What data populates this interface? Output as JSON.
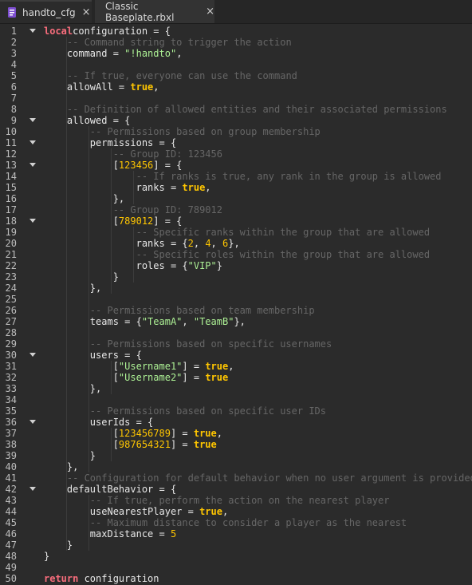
{
  "tabs": [
    {
      "label": "handto_cfg",
      "active": true
    },
    {
      "label": "Classic Baseplate.rbxl",
      "active": false
    }
  ],
  "close_glyph": "×",
  "colors": {
    "background": "#2b2b2b",
    "keyword": "#f86d7c",
    "boolean_number": "#ffc600",
    "string": "#adf195",
    "comment": "#666666",
    "text": "#e8e8e8"
  },
  "editor": {
    "lines": [
      {
        "n": "1",
        "fold": true,
        "tokens": [
          [
            "kw",
            "local"
          ],
          [
            "",
            "configuration = {"
          ]
        ]
      },
      {
        "n": "2",
        "tokens": [
          [
            "",
            "    "
          ],
          [
            "cm",
            "-- Command string to trigger the action"
          ]
        ]
      },
      {
        "n": "3",
        "tokens": [
          [
            "",
            "    command = "
          ],
          [
            "str",
            "\"!handto\""
          ],
          [
            "",
            ","
          ]
        ]
      },
      {
        "n": "4",
        "tokens": []
      },
      {
        "n": "5",
        "tokens": [
          [
            "",
            "    "
          ],
          [
            "cm",
            "-- If true, everyone can use the command"
          ]
        ]
      },
      {
        "n": "6",
        "tokens": [
          [
            "",
            "    allowAll = "
          ],
          [
            "bool",
            "true"
          ],
          [
            "",
            ","
          ]
        ]
      },
      {
        "n": "7",
        "tokens": []
      },
      {
        "n": "8",
        "tokens": [
          [
            "",
            "    "
          ],
          [
            "cm",
            "-- Definition of allowed entities and their associated permissions"
          ]
        ]
      },
      {
        "n": "9",
        "fold": true,
        "tokens": [
          [
            "",
            "    allowed = {"
          ]
        ]
      },
      {
        "n": "10",
        "tokens": [
          [
            "",
            "        "
          ],
          [
            "cm",
            "-- Permissions based on group membership"
          ]
        ]
      },
      {
        "n": "11",
        "fold": true,
        "tokens": [
          [
            "",
            "        permissions = {"
          ]
        ]
      },
      {
        "n": "12",
        "tokens": [
          [
            "",
            "            "
          ],
          [
            "cm",
            "-- Group ID: 123456"
          ]
        ]
      },
      {
        "n": "13",
        "fold": true,
        "tokens": [
          [
            "",
            "            ["
          ],
          [
            "num",
            "123456"
          ],
          [
            "",
            "] = {"
          ]
        ]
      },
      {
        "n": "14",
        "tokens": [
          [
            "",
            "                "
          ],
          [
            "cm",
            "-- If ranks is true, any rank in the group is allowed"
          ]
        ]
      },
      {
        "n": "15",
        "tokens": [
          [
            "",
            "                ranks = "
          ],
          [
            "bool",
            "true"
          ],
          [
            "",
            ","
          ]
        ]
      },
      {
        "n": "16",
        "tokens": [
          [
            "",
            "            },"
          ]
        ]
      },
      {
        "n": "17",
        "tokens": [
          [
            "",
            "            "
          ],
          [
            "cm",
            "-- Group ID: 789012"
          ]
        ]
      },
      {
        "n": "18",
        "fold": true,
        "tokens": [
          [
            "",
            "            ["
          ],
          [
            "num",
            "789012"
          ],
          [
            "",
            "] = {"
          ]
        ]
      },
      {
        "n": "19",
        "tokens": [
          [
            "",
            "                "
          ],
          [
            "cm",
            "-- Specific ranks within the group that are allowed"
          ]
        ]
      },
      {
        "n": "20",
        "tokens": [
          [
            "",
            "                ranks = {"
          ],
          [
            "num",
            "2"
          ],
          [
            "",
            ", "
          ],
          [
            "num",
            "4"
          ],
          [
            "",
            ", "
          ],
          [
            "num",
            "6"
          ],
          [
            "",
            "},"
          ]
        ]
      },
      {
        "n": "21",
        "tokens": [
          [
            "",
            "                "
          ],
          [
            "cm",
            "-- Specific roles within the group that are allowed"
          ]
        ]
      },
      {
        "n": "22",
        "tokens": [
          [
            "",
            "                roles = {"
          ],
          [
            "str",
            "\"VIP\""
          ],
          [
            "",
            "}"
          ]
        ]
      },
      {
        "n": "23",
        "tokens": [
          [
            "",
            "            }"
          ]
        ]
      },
      {
        "n": "24",
        "tokens": [
          [
            "",
            "        },"
          ]
        ]
      },
      {
        "n": "25",
        "tokens": []
      },
      {
        "n": "26",
        "tokens": [
          [
            "",
            "        "
          ],
          [
            "cm",
            "-- Permissions based on team membership"
          ]
        ]
      },
      {
        "n": "27",
        "tokens": [
          [
            "",
            "        teams = {"
          ],
          [
            "str",
            "\"TeamA\""
          ],
          [
            "",
            ", "
          ],
          [
            "str",
            "\"TeamB\""
          ],
          [
            "",
            "},"
          ]
        ]
      },
      {
        "n": "28",
        "tokens": []
      },
      {
        "n": "29",
        "tokens": [
          [
            "",
            "        "
          ],
          [
            "cm",
            "-- Permissions based on specific usernames"
          ]
        ]
      },
      {
        "n": "30",
        "fold": true,
        "tokens": [
          [
            "",
            "        users = {"
          ]
        ]
      },
      {
        "n": "31",
        "tokens": [
          [
            "",
            "            ["
          ],
          [
            "str",
            "\"Username1\""
          ],
          [
            "",
            "] = "
          ],
          [
            "bool",
            "true"
          ],
          [
            "",
            ","
          ]
        ]
      },
      {
        "n": "32",
        "tokens": [
          [
            "",
            "            ["
          ],
          [
            "str",
            "\"Username2\""
          ],
          [
            "",
            "] = "
          ],
          [
            "bool",
            "true"
          ]
        ]
      },
      {
        "n": "33",
        "tokens": [
          [
            "",
            "        },"
          ]
        ]
      },
      {
        "n": "34",
        "tokens": []
      },
      {
        "n": "35",
        "tokens": [
          [
            "",
            "        "
          ],
          [
            "cm",
            "-- Permissions based on specific user IDs"
          ]
        ]
      },
      {
        "n": "36",
        "fold": true,
        "tokens": [
          [
            "",
            "        userIds = {"
          ]
        ]
      },
      {
        "n": "37",
        "tokens": [
          [
            "",
            "            ["
          ],
          [
            "num",
            "123456789"
          ],
          [
            "",
            "] = "
          ],
          [
            "bool",
            "true"
          ],
          [
            "",
            ","
          ]
        ]
      },
      {
        "n": "38",
        "tokens": [
          [
            "",
            "            ["
          ],
          [
            "num",
            "987654321"
          ],
          [
            "",
            "] = "
          ],
          [
            "bool",
            "true"
          ]
        ]
      },
      {
        "n": "39",
        "tokens": [
          [
            "",
            "        }"
          ]
        ]
      },
      {
        "n": "40",
        "tokens": [
          [
            "",
            "    },"
          ]
        ]
      },
      {
        "n": "41",
        "tokens": [
          [
            "",
            "    "
          ],
          [
            "cm",
            "-- Configuration for default behavior when no user argument is provided"
          ]
        ]
      },
      {
        "n": "42",
        "fold": true,
        "tokens": [
          [
            "",
            "    defaultBehavior = {"
          ]
        ]
      },
      {
        "n": "43",
        "tokens": [
          [
            "",
            "        "
          ],
          [
            "cm",
            "-- If true, perform the action on the nearest player"
          ]
        ]
      },
      {
        "n": "44",
        "tokens": [
          [
            "",
            "        useNearestPlayer = "
          ],
          [
            "bool",
            "true"
          ],
          [
            "",
            ","
          ]
        ]
      },
      {
        "n": "45",
        "tokens": [
          [
            "",
            "        "
          ],
          [
            "cm",
            "-- Maximum distance to consider a player as the nearest"
          ]
        ]
      },
      {
        "n": "46",
        "tokens": [
          [
            "",
            "        maxDistance = "
          ],
          [
            "num",
            "5"
          ]
        ]
      },
      {
        "n": "47",
        "tokens": [
          [
            "",
            "    }"
          ]
        ]
      },
      {
        "n": "48",
        "tokens": [
          [
            "",
            "}"
          ]
        ]
      },
      {
        "n": "49",
        "tokens": []
      },
      {
        "n": "50",
        "tokens": [
          [
            "kw",
            "return"
          ],
          [
            "",
            " configuration"
          ]
        ]
      }
    ]
  }
}
